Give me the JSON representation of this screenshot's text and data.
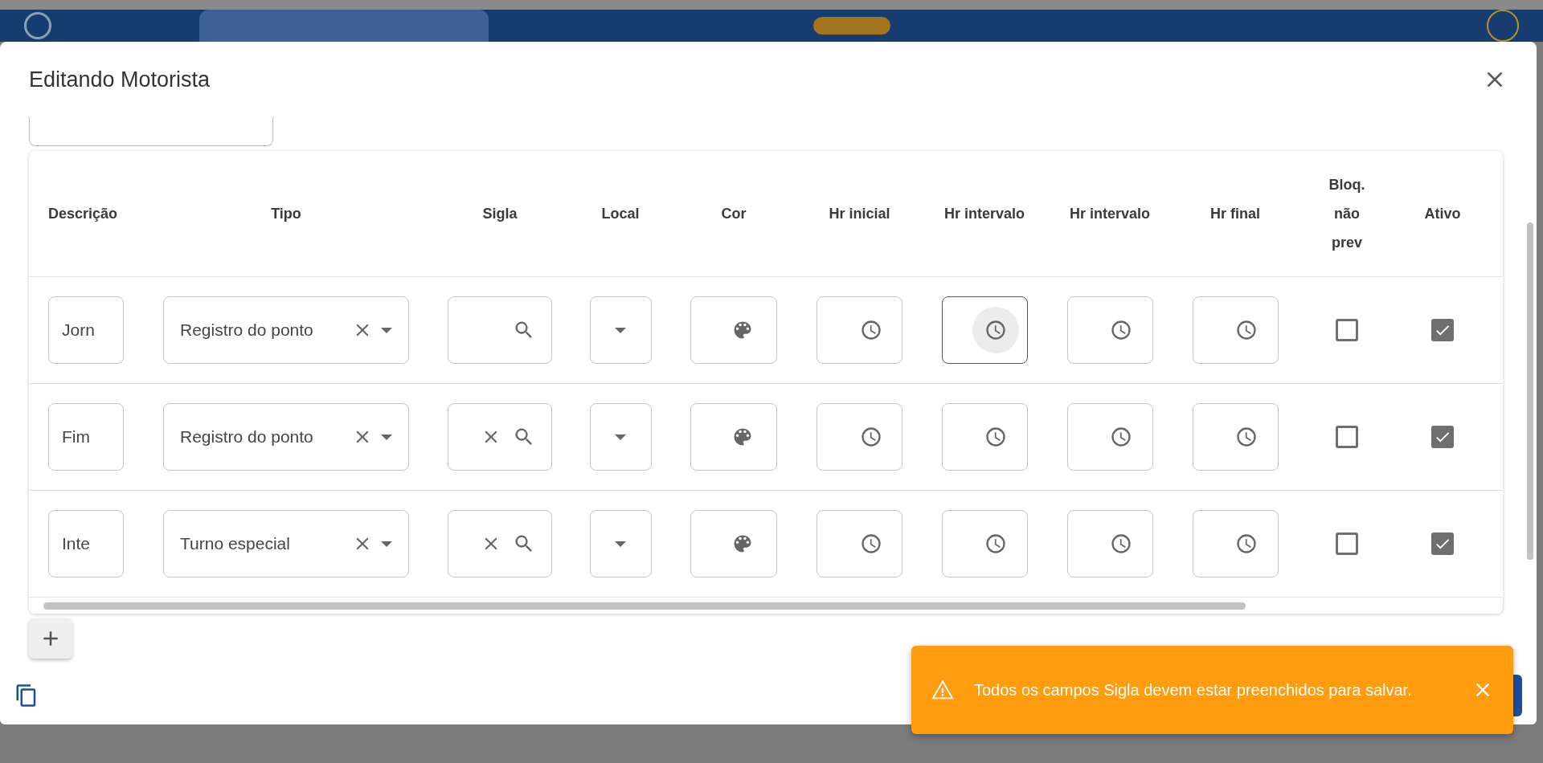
{
  "dialog": {
    "title": "Editando Motorista"
  },
  "table": {
    "columns": [
      "Descrição",
      "Tipo",
      "Sigla",
      "Local",
      "Cor",
      "Hr inicial",
      "Hr intervalo",
      "Hr intervalo",
      "Hr final",
      "Bloq. não prev",
      "Ativo"
    ],
    "rows": [
      {
        "description": "Jorn",
        "type": "Registro do ponto",
        "sigla_clearable": false,
        "times": [
          {
            "focused": false
          },
          {
            "focused": true
          },
          {
            "focused": false
          },
          {
            "focused": false
          }
        ],
        "bloq_checked": false,
        "active_checked": true
      },
      {
        "description": "Fim",
        "type": "Registro do ponto",
        "sigla_clearable": true,
        "times": [
          {
            "focused": false
          },
          {
            "focused": false
          },
          {
            "focused": false
          },
          {
            "focused": false
          }
        ],
        "bloq_checked": false,
        "active_checked": true
      },
      {
        "description": "Inte",
        "type": "Turno especial",
        "sigla_clearable": true,
        "times": [
          {
            "focused": false
          },
          {
            "focused": false
          },
          {
            "focused": false
          },
          {
            "focused": false
          }
        ],
        "bloq_checked": false,
        "active_checked": true
      }
    ]
  },
  "toast": {
    "kind": "warning",
    "message": "Todos os campos Sigla devem estar preenchidos para salvar."
  }
}
